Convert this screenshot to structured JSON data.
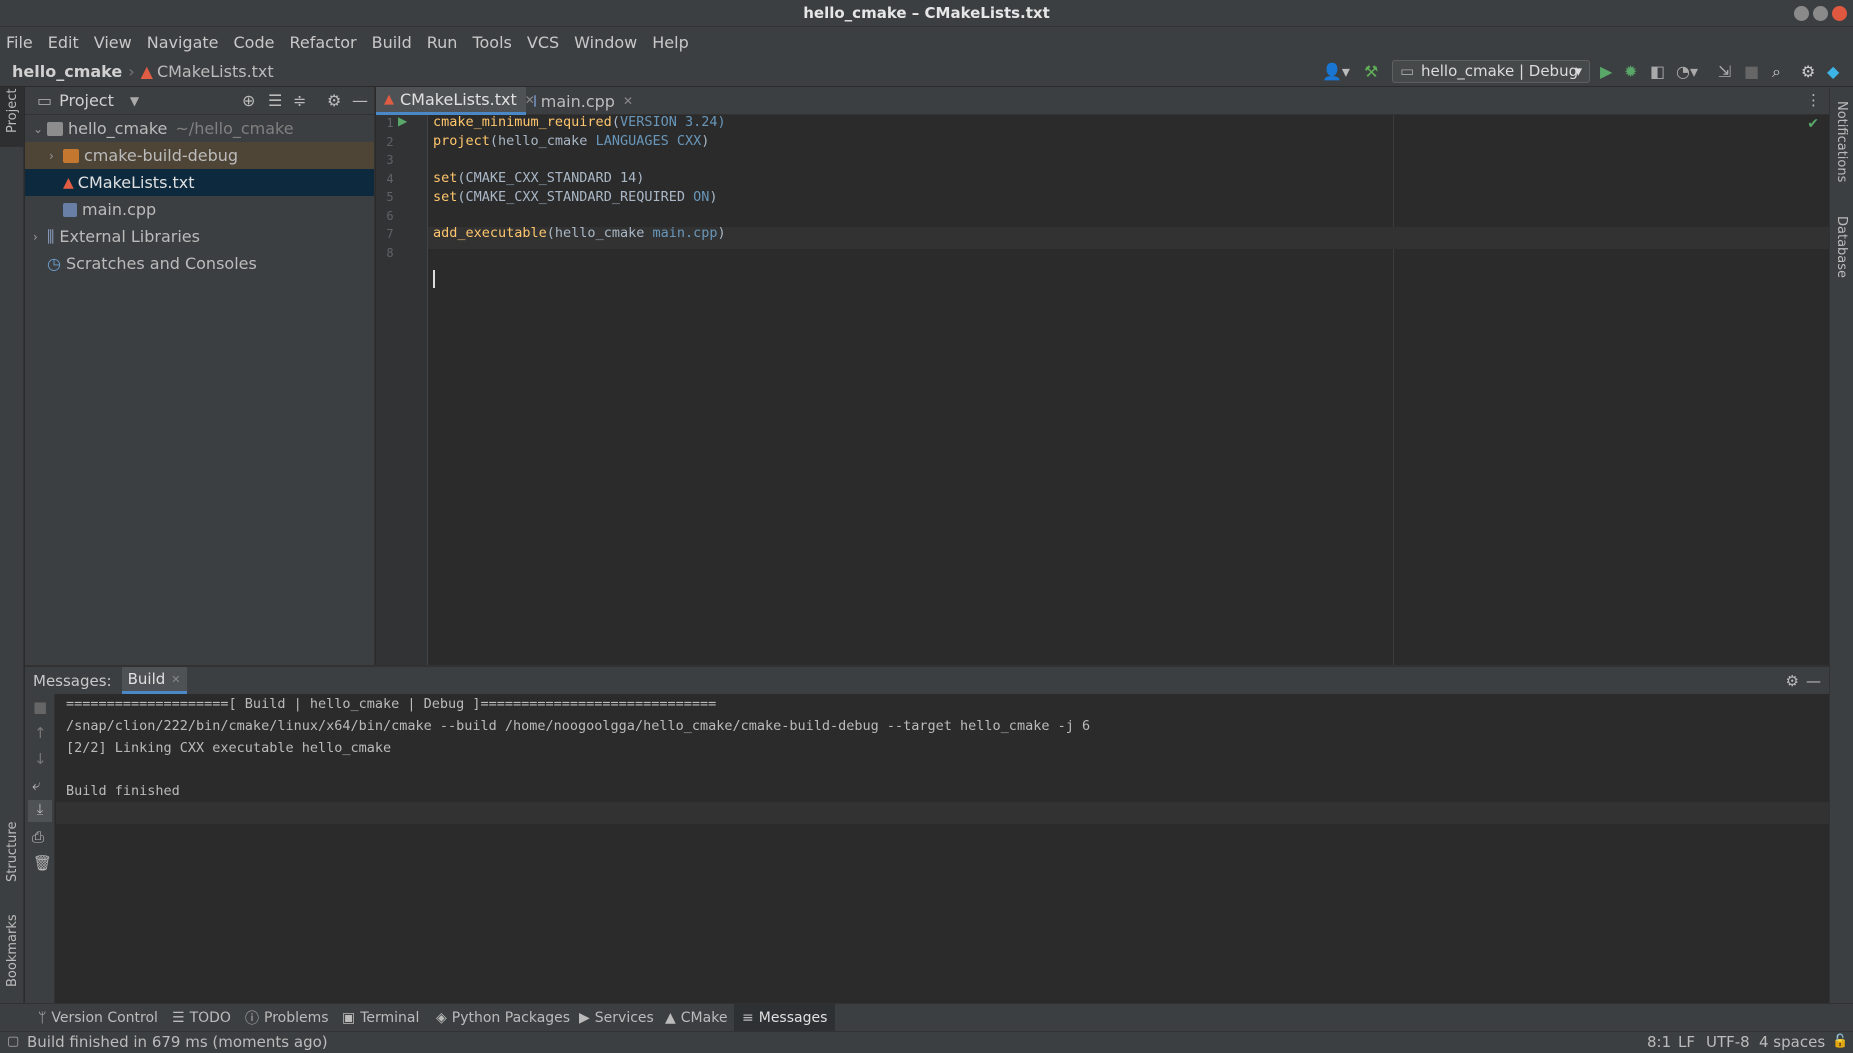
{
  "window": {
    "title": "hello_cmake – CMakeLists.txt"
  },
  "menu": [
    "File",
    "Edit",
    "View",
    "Navigate",
    "Code",
    "Refactor",
    "Build",
    "Run",
    "Tools",
    "VCS",
    "Window",
    "Help"
  ],
  "breadcrumb": {
    "project": "hello_cmake",
    "file": "CMakeLists.txt"
  },
  "toolbar": {
    "run_config": "hello_cmake | Debug"
  },
  "left_strip": {
    "project": "Project",
    "structure": "Structure",
    "bookmarks": "Bookmarks"
  },
  "right_strip": {
    "notifications": "Notifications",
    "database": "Database"
  },
  "project_panel": {
    "title": "Project",
    "tree": [
      {
        "label": "hello_cmake",
        "hint": "~/hello_cmake"
      },
      {
        "label": "cmake-build-debug"
      },
      {
        "label": "CMakeLists.txt"
      },
      {
        "label": "main.cpp"
      },
      {
        "label": "External Libraries"
      },
      {
        "label": "Scratches and Consoles"
      }
    ]
  },
  "editor": {
    "tabs": [
      {
        "label": "CMakeLists.txt",
        "active": true
      },
      {
        "label": "main.cpp",
        "active": false
      }
    ],
    "line_numbers": [
      "1",
      "2",
      "3",
      "4",
      "5",
      "6",
      "7",
      "8"
    ],
    "lines": [
      {
        "fn": "cmake_minimum_required",
        "open": "(",
        "kw": "VERSION",
        "rest": " 3.24)"
      },
      {
        "fn": "project",
        "open": "(hello_cmake ",
        "kw": "LANGUAGES CXX",
        "rest": ")"
      },
      {
        "fn": "",
        "open": "",
        "kw": "",
        "rest": ""
      },
      {
        "fn": "set",
        "open": "(CMAKE_CXX_STANDARD 14)",
        "kw": "",
        "rest": ""
      },
      {
        "fn": "set",
        "open": "(CMAKE_CXX_STANDARD_REQUIRED ",
        "kw": "ON",
        "rest": ")"
      },
      {
        "fn": "",
        "open": "",
        "kw": "",
        "rest": ""
      },
      {
        "fn": "add_executable",
        "open": "(hello_cmake ",
        "kw": "main.cpp",
        "rest": ")"
      },
      {
        "fn": "",
        "open": "",
        "kw": "",
        "rest": ""
      }
    ]
  },
  "messages": {
    "label": "Messages:",
    "tab": "Build",
    "output": [
      "====================[ Build | hello_cmake | Debug ]=============================",
      "/snap/clion/222/bin/cmake/linux/x64/bin/cmake --build /home/noogoolgga/hello_cmake/cmake-build-debug --target hello_cmake -j 6",
      "[2/2] Linking CXX executable hello_cmake",
      "",
      "Build finished"
    ]
  },
  "bottom_tools": [
    "Version Control",
    "TODO",
    "Problems",
    "Terminal",
    "Python Packages",
    "Services",
    "CMake",
    "Messages"
  ],
  "status": {
    "message": "Build finished in 679 ms (moments ago)",
    "position": "8:1",
    "line_sep": "LF",
    "encoding": "UTF-8",
    "indent": "4 spaces"
  }
}
